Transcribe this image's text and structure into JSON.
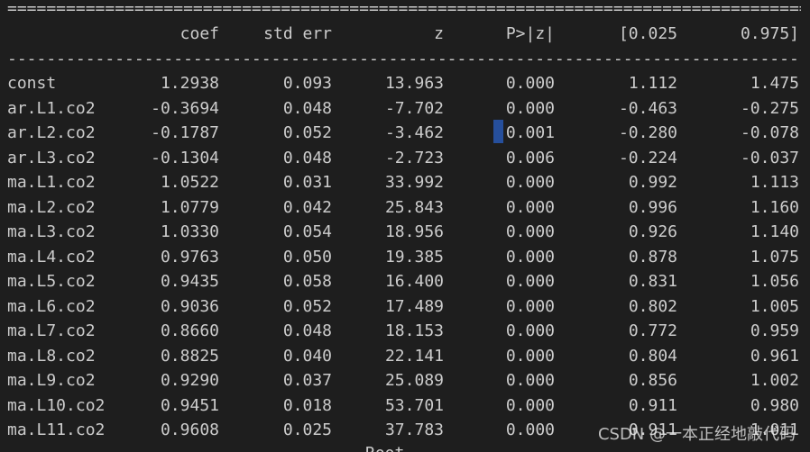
{
  "rules": {
    "top": "==============================================================================================================",
    "mid": "--------------------------------------------------------------------------------------------------------------"
  },
  "header": {
    "coef": "coef",
    "std_err": "std err",
    "z": "z",
    "p": "P>|z|",
    "ci_low": "[0.025",
    "ci_high": "0.975]"
  },
  "rows": [
    {
      "name": "const",
      "coef": "1.2938",
      "std_err": "0.093",
      "z": "13.963",
      "p": "0.000",
      "ci_low": "1.112",
      "ci_high": "1.475"
    },
    {
      "name": "ar.L1.co2",
      "coef": "-0.3694",
      "std_err": "0.048",
      "z": "-7.702",
      "p": "0.000",
      "ci_low": "-0.463",
      "ci_high": "-0.275"
    },
    {
      "name": "ar.L2.co2",
      "coef": "-0.1787",
      "std_err": "0.052",
      "z": "-3.462",
      "p": "0.001",
      "ci_low": "-0.280",
      "ci_high": "-0.078"
    },
    {
      "name": "ar.L3.co2",
      "coef": "-0.1304",
      "std_err": "0.048",
      "z": "-2.723",
      "p": "0.006",
      "ci_low": "-0.224",
      "ci_high": "-0.037"
    },
    {
      "name": "ma.L1.co2",
      "coef": "1.0522",
      "std_err": "0.031",
      "z": "33.992",
      "p": "0.000",
      "ci_low": "0.992",
      "ci_high": "1.113"
    },
    {
      "name": "ma.L2.co2",
      "coef": "1.0779",
      "std_err": "0.042",
      "z": "25.843",
      "p": "0.000",
      "ci_low": "0.996",
      "ci_high": "1.160"
    },
    {
      "name": "ma.L3.co2",
      "coef": "1.0330",
      "std_err": "0.054",
      "z": "18.956",
      "p": "0.000",
      "ci_low": "0.926",
      "ci_high": "1.140"
    },
    {
      "name": "ma.L4.co2",
      "coef": "0.9763",
      "std_err": "0.050",
      "z": "19.385",
      "p": "0.000",
      "ci_low": "0.878",
      "ci_high": "1.075"
    },
    {
      "name": "ma.L5.co2",
      "coef": "0.9435",
      "std_err": "0.058",
      "z": "16.400",
      "p": "0.000",
      "ci_low": "0.831",
      "ci_high": "1.056"
    },
    {
      "name": "ma.L6.co2",
      "coef": "0.9036",
      "std_err": "0.052",
      "z": "17.489",
      "p": "0.000",
      "ci_low": "0.802",
      "ci_high": "1.005"
    },
    {
      "name": "ma.L7.co2",
      "coef": "0.8660",
      "std_err": "0.048",
      "z": "18.153",
      "p": "0.000",
      "ci_low": "0.772",
      "ci_high": "0.959"
    },
    {
      "name": "ma.L8.co2",
      "coef": "0.8825",
      "std_err": "0.040",
      "z": "22.141",
      "p": "0.000",
      "ci_low": "0.804",
      "ci_high": "0.961"
    },
    {
      "name": "ma.L9.co2",
      "coef": "0.9290",
      "std_err": "0.037",
      "z": "25.089",
      "p": "0.000",
      "ci_low": "0.856",
      "ci_high": "1.002"
    },
    {
      "name": "ma.L10.co2",
      "coef": "0.9451",
      "std_err": "0.018",
      "z": "53.701",
      "p": "0.000",
      "ci_low": "0.911",
      "ci_high": "0.980"
    },
    {
      "name": "ma.L11.co2",
      "coef": "0.9608",
      "std_err": "0.025",
      "z": "37.783",
      "p": "0.000",
      "ci_low": "0.911",
      "ci_high": "1.011"
    }
  ],
  "cutoff_text": "Root",
  "watermark": "CSDN @一本正经地敲代码",
  "colors": {
    "background": "#1e1e1e",
    "text": "#cccccc",
    "cursor": "#264f9c"
  }
}
